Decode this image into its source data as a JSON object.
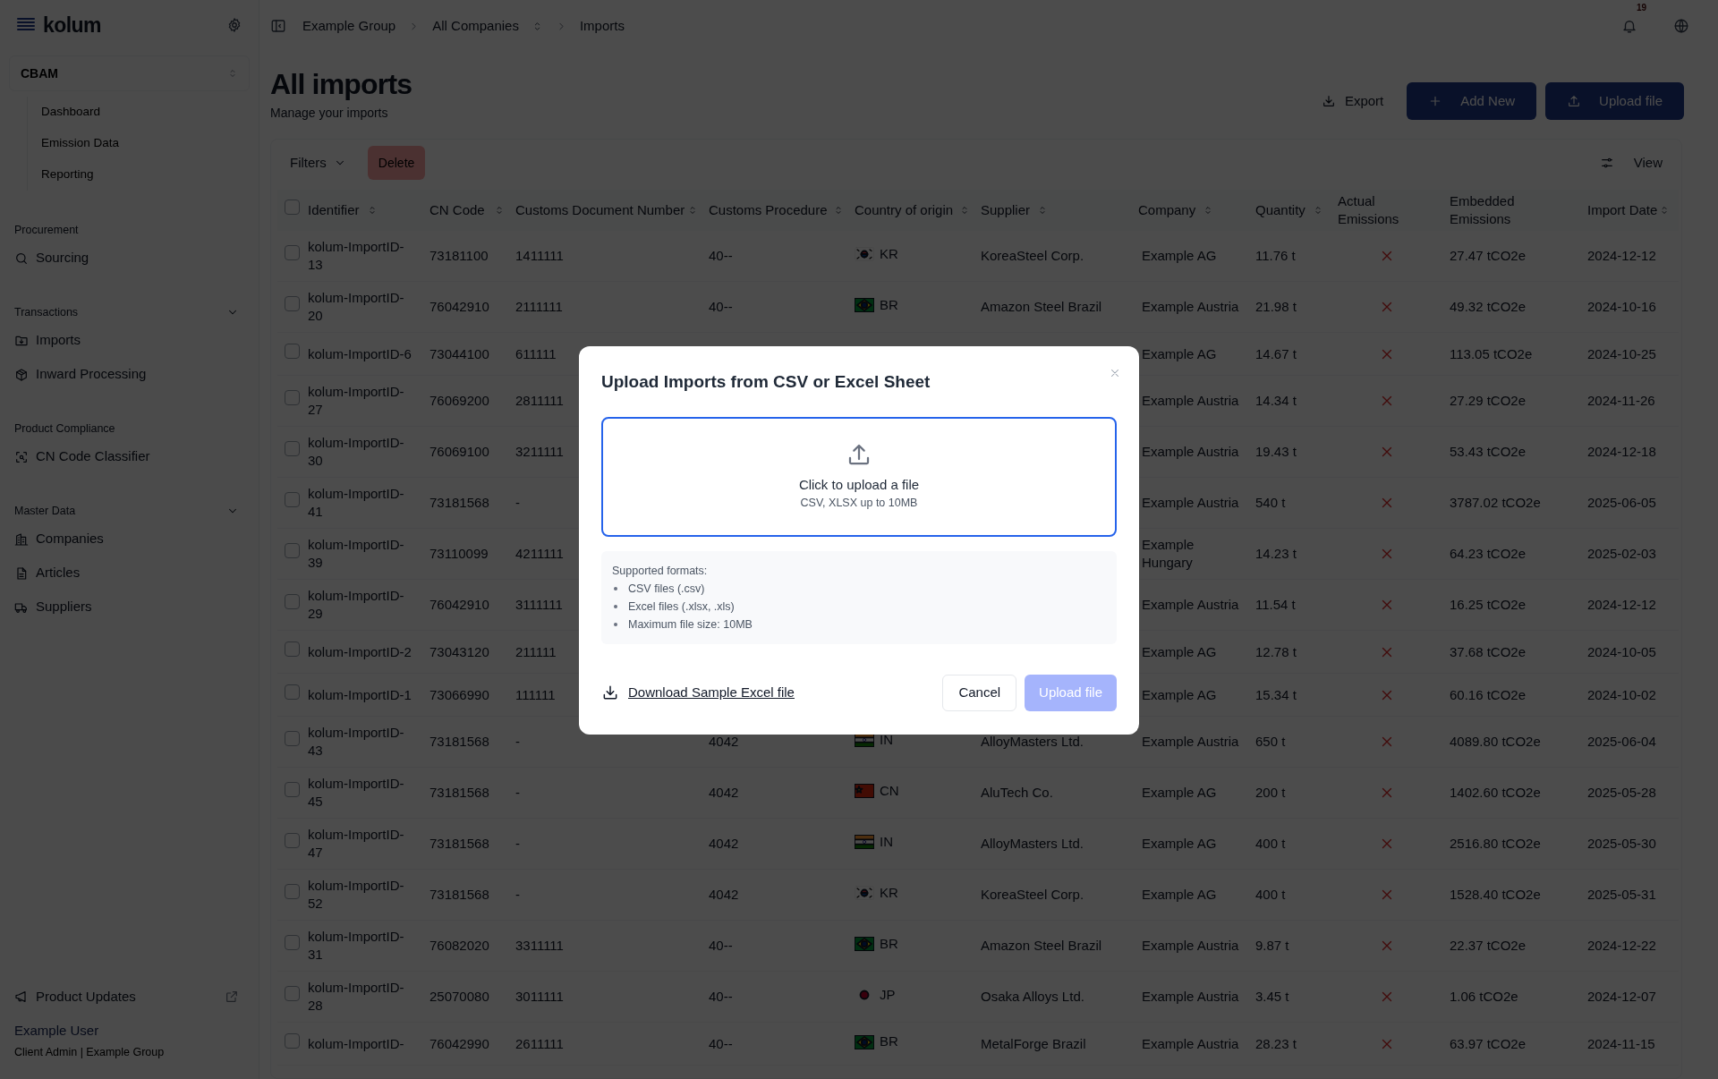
{
  "sidebar": {
    "logo": "kolum",
    "workspace": "CBAM",
    "module_items": [
      {
        "label": "Dashboard"
      },
      {
        "label": "Emission Data"
      },
      {
        "label": "Reporting"
      }
    ],
    "sections": [
      {
        "title": "Procurement",
        "kind": "group",
        "items": [
          {
            "label": "Sourcing"
          }
        ]
      },
      {
        "title": "Transactions",
        "kind": "collapsible",
        "expanded": true,
        "items": [
          {
            "label": "Imports"
          },
          {
            "label": "Inward Processing"
          }
        ]
      },
      {
        "title": "Product Compliance",
        "kind": "group",
        "items": [
          {
            "label": "CN Code Classifier"
          }
        ]
      },
      {
        "title": "Master Data",
        "kind": "collapsible",
        "expanded": true,
        "items": [
          {
            "label": "Companies"
          },
          {
            "label": "Articles"
          },
          {
            "label": "Suppliers"
          }
        ]
      }
    ],
    "product_updates": "Product Updates",
    "user_name": "Example User",
    "user_role": "Client Admin | Example Group"
  },
  "breadcrumb": [
    {
      "label": "Example Group",
      "kind": "link"
    },
    {
      "label": "All Companies",
      "kind": "select"
    },
    {
      "label": "Imports",
      "kind": "current"
    }
  ],
  "notifications": "19",
  "page": {
    "title": "All imports",
    "subtitle": "Manage your imports",
    "actions": [
      {
        "label": "Export",
        "kind": "outline"
      },
      {
        "label": "Add New",
        "kind": "primary"
      },
      {
        "label": "Upload file",
        "kind": "primary"
      }
    ]
  },
  "toolbar": {
    "filters": "Filters",
    "delete": {
      "label": "Delete",
      "disabled": true
    },
    "view": "View"
  },
  "table": {
    "select_all": {
      "checked": false
    },
    "columns": [
      {
        "label": "Identifier",
        "sortable": true
      },
      {
        "label": "CN Code",
        "sortable": true
      },
      {
        "label": "Customs Document Number",
        "sortable": true
      },
      {
        "label": "Customs Procedure",
        "sortable": true
      },
      {
        "label": "Country of origin",
        "sortable": true
      },
      {
        "label": "Supplier",
        "sortable": true
      },
      {
        "label": "Company",
        "sortable": true
      },
      {
        "label": "Quantity",
        "sortable": true
      },
      {
        "label": "Actual Emissions",
        "sortable": false
      },
      {
        "label": "Embedded Emissions",
        "sortable": false
      },
      {
        "label": "Import Date",
        "sortable": true
      }
    ],
    "rows": [
      {
        "checked": false,
        "identifier": "kolum-ImportID-13",
        "cn_code": "73181100",
        "document_number": "1411111",
        "procedure": "40--",
        "country": {
          "code": "KR",
          "kind": "korea"
        },
        "supplier": "KoreaSteel Corp.",
        "company": "Example AG",
        "quantity": "11.76 t",
        "actual_emissions": false,
        "embedded": "27.47 tCO2e",
        "date": "2024-12-12"
      },
      {
        "checked": false,
        "identifier": "kolum-ImportID-20",
        "cn_code": "76042910",
        "document_number": "2111111",
        "procedure": "40--",
        "country": {
          "code": "BR",
          "kind": "brazil"
        },
        "supplier": "Amazon Steel Brazil",
        "company": "Example Austria",
        "quantity": "21.98 t",
        "actual_emissions": false,
        "embedded": "49.32 tCO2e",
        "date": "2024-10-16"
      },
      {
        "checked": false,
        "identifier": "kolum-ImportID-6",
        "cn_code": "73044100",
        "document_number": "611111",
        "company": "Example AG",
        "quantity": "14.67 t",
        "actual_emissions": false,
        "embedded": "113.05 tCO2e",
        "date": "2024-10-25"
      },
      {
        "checked": false,
        "identifier": "kolum-ImportID-27",
        "cn_code": "76069200",
        "document_number": "2811111",
        "company": "Example Austria",
        "quantity": "14.34 t",
        "actual_emissions": false,
        "embedded": "27.29 tCO2e",
        "date": "2024-11-26"
      },
      {
        "checked": false,
        "identifier": "kolum-ImportID-30",
        "cn_code": "76069100",
        "document_number": "3211111",
        "company": "Example Austria",
        "quantity": "19.43 t",
        "actual_emissions": false,
        "embedded": "53.43 tCO2e",
        "date": "2024-12-18"
      },
      {
        "checked": false,
        "identifier": "kolum-ImportID-41",
        "cn_code": "73181568",
        "document_number": "-",
        "company": "Example Austria",
        "quantity": "540 t",
        "actual_emissions": false,
        "embedded": "3787.02 tCO2e",
        "date": "2025-06-05"
      },
      {
        "checked": false,
        "identifier": "kolum-ImportID-39",
        "cn_code": "73110099",
        "document_number": "4211111",
        "company": "Example Hungary",
        "quantity": "14.23 t",
        "actual_emissions": false,
        "embedded": "64.23 tCO2e",
        "date": "2025-02-03"
      },
      {
        "checked": false,
        "identifier": "kolum-ImportID-29",
        "cn_code": "76042910",
        "document_number": "3111111",
        "company": "Example Austria",
        "quantity": "11.54 t",
        "actual_emissions": false,
        "embedded": "16.25 tCO2e",
        "date": "2024-12-12"
      },
      {
        "checked": false,
        "identifier": "kolum-ImportID-2",
        "cn_code": "73043120",
        "document_number": "211111",
        "company": "Example AG",
        "quantity": "12.78 t",
        "actual_emissions": false,
        "embedded": "37.68 tCO2e",
        "date": "2024-10-05"
      },
      {
        "checked": false,
        "identifier": "kolum-ImportID-1",
        "cn_code": "73066990",
        "document_number": "111111",
        "company": "Example AG",
        "quantity": "15.34 t",
        "actual_emissions": false,
        "embedded": "60.16 tCO2e",
        "date": "2024-10-02"
      },
      {
        "checked": false,
        "identifier": "kolum-ImportID-43",
        "cn_code": "73181568",
        "document_number": "-",
        "procedure": "4042",
        "country": {
          "code": "IN",
          "kind": "india"
        },
        "supplier": "AlloyMasters Ltd.",
        "company": "Example Austria",
        "quantity": "650 t",
        "actual_emissions": false,
        "embedded": "4089.80 tCO2e",
        "date": "2025-06-04"
      },
      {
        "checked": false,
        "identifier": "kolum-ImportID-45",
        "cn_code": "73181568",
        "document_number": "-",
        "procedure": "4042",
        "country": {
          "code": "CN",
          "kind": "china"
        },
        "supplier": "AluTech Co.",
        "company": "Example AG",
        "quantity": "200 t",
        "actual_emissions": false,
        "embedded": "1402.60 tCO2e",
        "date": "2025-05-28"
      },
      {
        "checked": false,
        "identifier": "kolum-ImportID-47",
        "cn_code": "73181568",
        "document_number": "-",
        "procedure": "4042",
        "country": {
          "code": "IN",
          "kind": "india"
        },
        "supplier": "AlloyMasters Ltd.",
        "company": "Example AG",
        "quantity": "400 t",
        "actual_emissions": false,
        "embedded": "2516.80 tCO2e",
        "date": "2025-05-30"
      },
      {
        "checked": false,
        "identifier": "kolum-ImportID-52",
        "cn_code": "73181568",
        "document_number": "-",
        "procedure": "4042",
        "country": {
          "code": "KR",
          "kind": "korea"
        },
        "supplier": "KoreaSteel Corp.",
        "company": "Example AG",
        "quantity": "400 t",
        "actual_emissions": false,
        "embedded": "1528.40 tCO2e",
        "date": "2025-05-31"
      },
      {
        "checked": false,
        "identifier": "kolum-ImportID-31",
        "cn_code": "76082020",
        "document_number": "3311111",
        "procedure": "40--",
        "country": {
          "code": "BR",
          "kind": "brazil"
        },
        "supplier": "Amazon Steel Brazil",
        "company": "Example Austria",
        "quantity": "9.87 t",
        "actual_emissions": false,
        "embedded": "22.37 tCO2e",
        "date": "2024-12-22"
      },
      {
        "checked": false,
        "identifier": "kolum-ImportID-28",
        "cn_code": "25070080",
        "document_number": "3011111",
        "procedure": "40--",
        "country": {
          "code": "JP",
          "kind": "japan"
        },
        "supplier": "Osaka Alloys Ltd.",
        "company": "Example Austria",
        "quantity": "3.45 t",
        "actual_emissions": false,
        "embedded": "1.06 tCO2e",
        "date": "2024-12-07"
      },
      {
        "checked": false,
        "identifier": "kolum-ImportID-",
        "cn_code": "76042990",
        "document_number": "2611111",
        "procedure": "40--",
        "country": {
          "code": "BR",
          "kind": "brazil"
        },
        "supplier": "MetalForge Brazil",
        "company": "Example Austria",
        "quantity": "28.23 t",
        "actual_emissions": false,
        "embedded": "63.97 tCO2e",
        "date": "2024-11-15"
      }
    ]
  },
  "modal": {
    "title": "Upload Imports from CSV or Excel Sheet",
    "dropzone_title": "Click to upload a file",
    "dropzone_hint": "CSV, XLSX up to 10MB",
    "formats_heading": "Supported formats:",
    "formats": [
      "CSV files (.csv)",
      "Excel files (.xlsx, .xls)",
      "Maximum file size: 10MB"
    ],
    "download_link": "Download Sample Excel file",
    "cancel": "Cancel",
    "upload": {
      "label": "Upload file",
      "disabled": true
    }
  }
}
